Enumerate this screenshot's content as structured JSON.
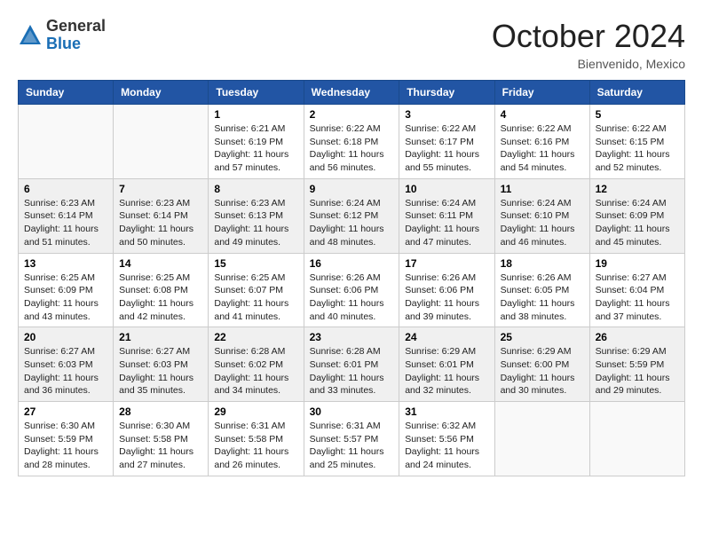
{
  "logo": {
    "general": "General",
    "blue": "Blue"
  },
  "header": {
    "month": "October 2024",
    "location": "Bienvenido, Mexico"
  },
  "weekdays": [
    "Sunday",
    "Monday",
    "Tuesday",
    "Wednesday",
    "Thursday",
    "Friday",
    "Saturday"
  ],
  "weeks": [
    [
      {
        "day": "",
        "info": ""
      },
      {
        "day": "",
        "info": ""
      },
      {
        "day": "1",
        "info": "Sunrise: 6:21 AM\nSunset: 6:19 PM\nDaylight: 11 hours and 57 minutes."
      },
      {
        "day": "2",
        "info": "Sunrise: 6:22 AM\nSunset: 6:18 PM\nDaylight: 11 hours and 56 minutes."
      },
      {
        "day": "3",
        "info": "Sunrise: 6:22 AM\nSunset: 6:17 PM\nDaylight: 11 hours and 55 minutes."
      },
      {
        "day": "4",
        "info": "Sunrise: 6:22 AM\nSunset: 6:16 PM\nDaylight: 11 hours and 54 minutes."
      },
      {
        "day": "5",
        "info": "Sunrise: 6:22 AM\nSunset: 6:15 PM\nDaylight: 11 hours and 52 minutes."
      }
    ],
    [
      {
        "day": "6",
        "info": "Sunrise: 6:23 AM\nSunset: 6:14 PM\nDaylight: 11 hours and 51 minutes."
      },
      {
        "day": "7",
        "info": "Sunrise: 6:23 AM\nSunset: 6:14 PM\nDaylight: 11 hours and 50 minutes."
      },
      {
        "day": "8",
        "info": "Sunrise: 6:23 AM\nSunset: 6:13 PM\nDaylight: 11 hours and 49 minutes."
      },
      {
        "day": "9",
        "info": "Sunrise: 6:24 AM\nSunset: 6:12 PM\nDaylight: 11 hours and 48 minutes."
      },
      {
        "day": "10",
        "info": "Sunrise: 6:24 AM\nSunset: 6:11 PM\nDaylight: 11 hours and 47 minutes."
      },
      {
        "day": "11",
        "info": "Sunrise: 6:24 AM\nSunset: 6:10 PM\nDaylight: 11 hours and 46 minutes."
      },
      {
        "day": "12",
        "info": "Sunrise: 6:24 AM\nSunset: 6:09 PM\nDaylight: 11 hours and 45 minutes."
      }
    ],
    [
      {
        "day": "13",
        "info": "Sunrise: 6:25 AM\nSunset: 6:09 PM\nDaylight: 11 hours and 43 minutes."
      },
      {
        "day": "14",
        "info": "Sunrise: 6:25 AM\nSunset: 6:08 PM\nDaylight: 11 hours and 42 minutes."
      },
      {
        "day": "15",
        "info": "Sunrise: 6:25 AM\nSunset: 6:07 PM\nDaylight: 11 hours and 41 minutes."
      },
      {
        "day": "16",
        "info": "Sunrise: 6:26 AM\nSunset: 6:06 PM\nDaylight: 11 hours and 40 minutes."
      },
      {
        "day": "17",
        "info": "Sunrise: 6:26 AM\nSunset: 6:06 PM\nDaylight: 11 hours and 39 minutes."
      },
      {
        "day": "18",
        "info": "Sunrise: 6:26 AM\nSunset: 6:05 PM\nDaylight: 11 hours and 38 minutes."
      },
      {
        "day": "19",
        "info": "Sunrise: 6:27 AM\nSunset: 6:04 PM\nDaylight: 11 hours and 37 minutes."
      }
    ],
    [
      {
        "day": "20",
        "info": "Sunrise: 6:27 AM\nSunset: 6:03 PM\nDaylight: 11 hours and 36 minutes."
      },
      {
        "day": "21",
        "info": "Sunrise: 6:27 AM\nSunset: 6:03 PM\nDaylight: 11 hours and 35 minutes."
      },
      {
        "day": "22",
        "info": "Sunrise: 6:28 AM\nSunset: 6:02 PM\nDaylight: 11 hours and 34 minutes."
      },
      {
        "day": "23",
        "info": "Sunrise: 6:28 AM\nSunset: 6:01 PM\nDaylight: 11 hours and 33 minutes."
      },
      {
        "day": "24",
        "info": "Sunrise: 6:29 AM\nSunset: 6:01 PM\nDaylight: 11 hours and 32 minutes."
      },
      {
        "day": "25",
        "info": "Sunrise: 6:29 AM\nSunset: 6:00 PM\nDaylight: 11 hours and 30 minutes."
      },
      {
        "day": "26",
        "info": "Sunrise: 6:29 AM\nSunset: 5:59 PM\nDaylight: 11 hours and 29 minutes."
      }
    ],
    [
      {
        "day": "27",
        "info": "Sunrise: 6:30 AM\nSunset: 5:59 PM\nDaylight: 11 hours and 28 minutes."
      },
      {
        "day": "28",
        "info": "Sunrise: 6:30 AM\nSunset: 5:58 PM\nDaylight: 11 hours and 27 minutes."
      },
      {
        "day": "29",
        "info": "Sunrise: 6:31 AM\nSunset: 5:58 PM\nDaylight: 11 hours and 26 minutes."
      },
      {
        "day": "30",
        "info": "Sunrise: 6:31 AM\nSunset: 5:57 PM\nDaylight: 11 hours and 25 minutes."
      },
      {
        "day": "31",
        "info": "Sunrise: 6:32 AM\nSunset: 5:56 PM\nDaylight: 11 hours and 24 minutes."
      },
      {
        "day": "",
        "info": ""
      },
      {
        "day": "",
        "info": ""
      }
    ]
  ]
}
